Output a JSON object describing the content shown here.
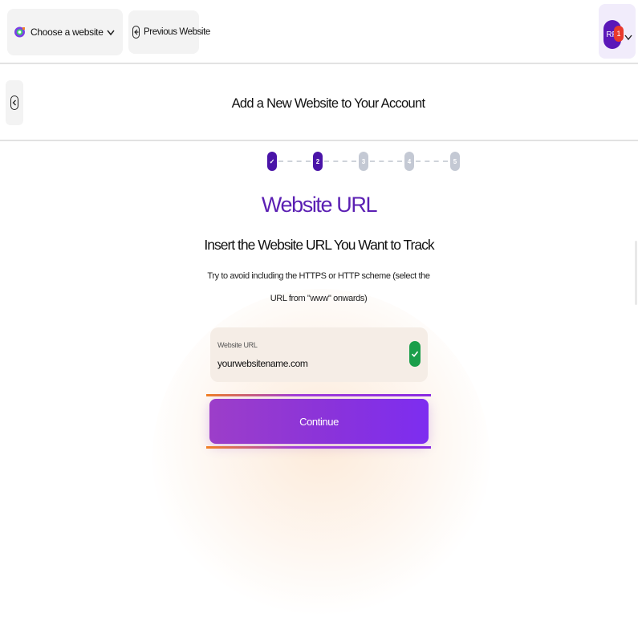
{
  "topbar": {
    "site_select": {
      "label": "Choose a website",
      "icon": "chevron-down-icon"
    },
    "previous_website": {
      "label": "Previous Website",
      "icon": "arrow-left-circle-icon"
    },
    "user": {
      "initials": "RF",
      "notification_count": "1"
    }
  },
  "header": {
    "back_icon": "arrow-left-circle-icon",
    "title": "Add a New Website to Your Account"
  },
  "stepper": {
    "steps": [
      {
        "label": "✓",
        "state": "done"
      },
      {
        "label": "2",
        "state": "active"
      },
      {
        "label": "3",
        "state": "todo"
      },
      {
        "label": "4",
        "state": "todo"
      },
      {
        "label": "5",
        "state": "todo"
      }
    ]
  },
  "main": {
    "section_title": "Website URL",
    "subtitle": "Insert the Website URL You Want to Track",
    "hint": "Try to avoid including the HTTPS or HTTP scheme (select the URL from \"www\" onwards)",
    "url_field": {
      "label": "Website URL",
      "value": "yourwebsitename.com",
      "valid_icon": "check-circle-icon"
    },
    "continue_label": "Continue"
  },
  "colors": {
    "accent": "#5b1fb3",
    "button_gradient_start": "#9c3ec9",
    "button_gradient_end": "#7d2df0",
    "success": "#1a9e4a",
    "notification": "#e83a2c"
  }
}
